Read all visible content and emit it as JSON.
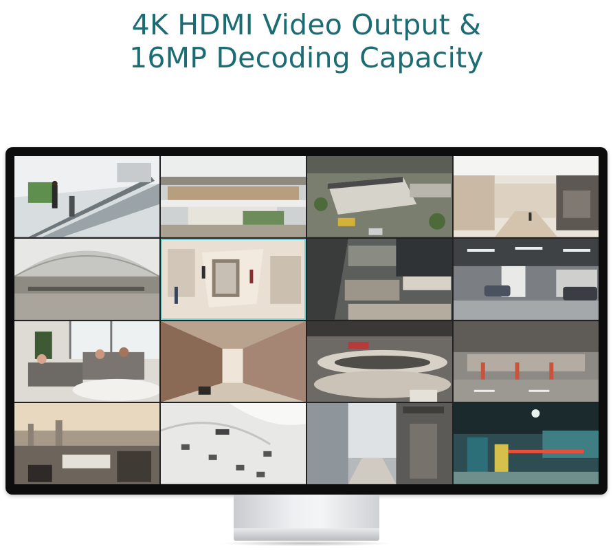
{
  "headline": {
    "line1": "4K HDMI Video Output &",
    "line2": "16MP Decoding Capacity"
  },
  "colors": {
    "headline": "#1b6c73",
    "bezel": "#0d0d0d",
    "selection": "#6fd3d3"
  },
  "camera_feeds": [
    {
      "name": "feed-escalator"
    },
    {
      "name": "feed-mall-atrium"
    },
    {
      "name": "feed-rooftop-plaza"
    },
    {
      "name": "feed-shopping-street"
    },
    {
      "name": "feed-glass-dome-mall"
    },
    {
      "name": "feed-store-aisle",
      "selected": true
    },
    {
      "name": "feed-mall-overhead"
    },
    {
      "name": "feed-parking-garage"
    },
    {
      "name": "feed-office-lounge"
    },
    {
      "name": "feed-arcade-corridor"
    },
    {
      "name": "feed-mall-levels"
    },
    {
      "name": "feed-underground-parking"
    },
    {
      "name": "feed-balcony-skyline"
    },
    {
      "name": "feed-white-atrium"
    },
    {
      "name": "feed-city-street"
    },
    {
      "name": "feed-parking-gate"
    }
  ]
}
